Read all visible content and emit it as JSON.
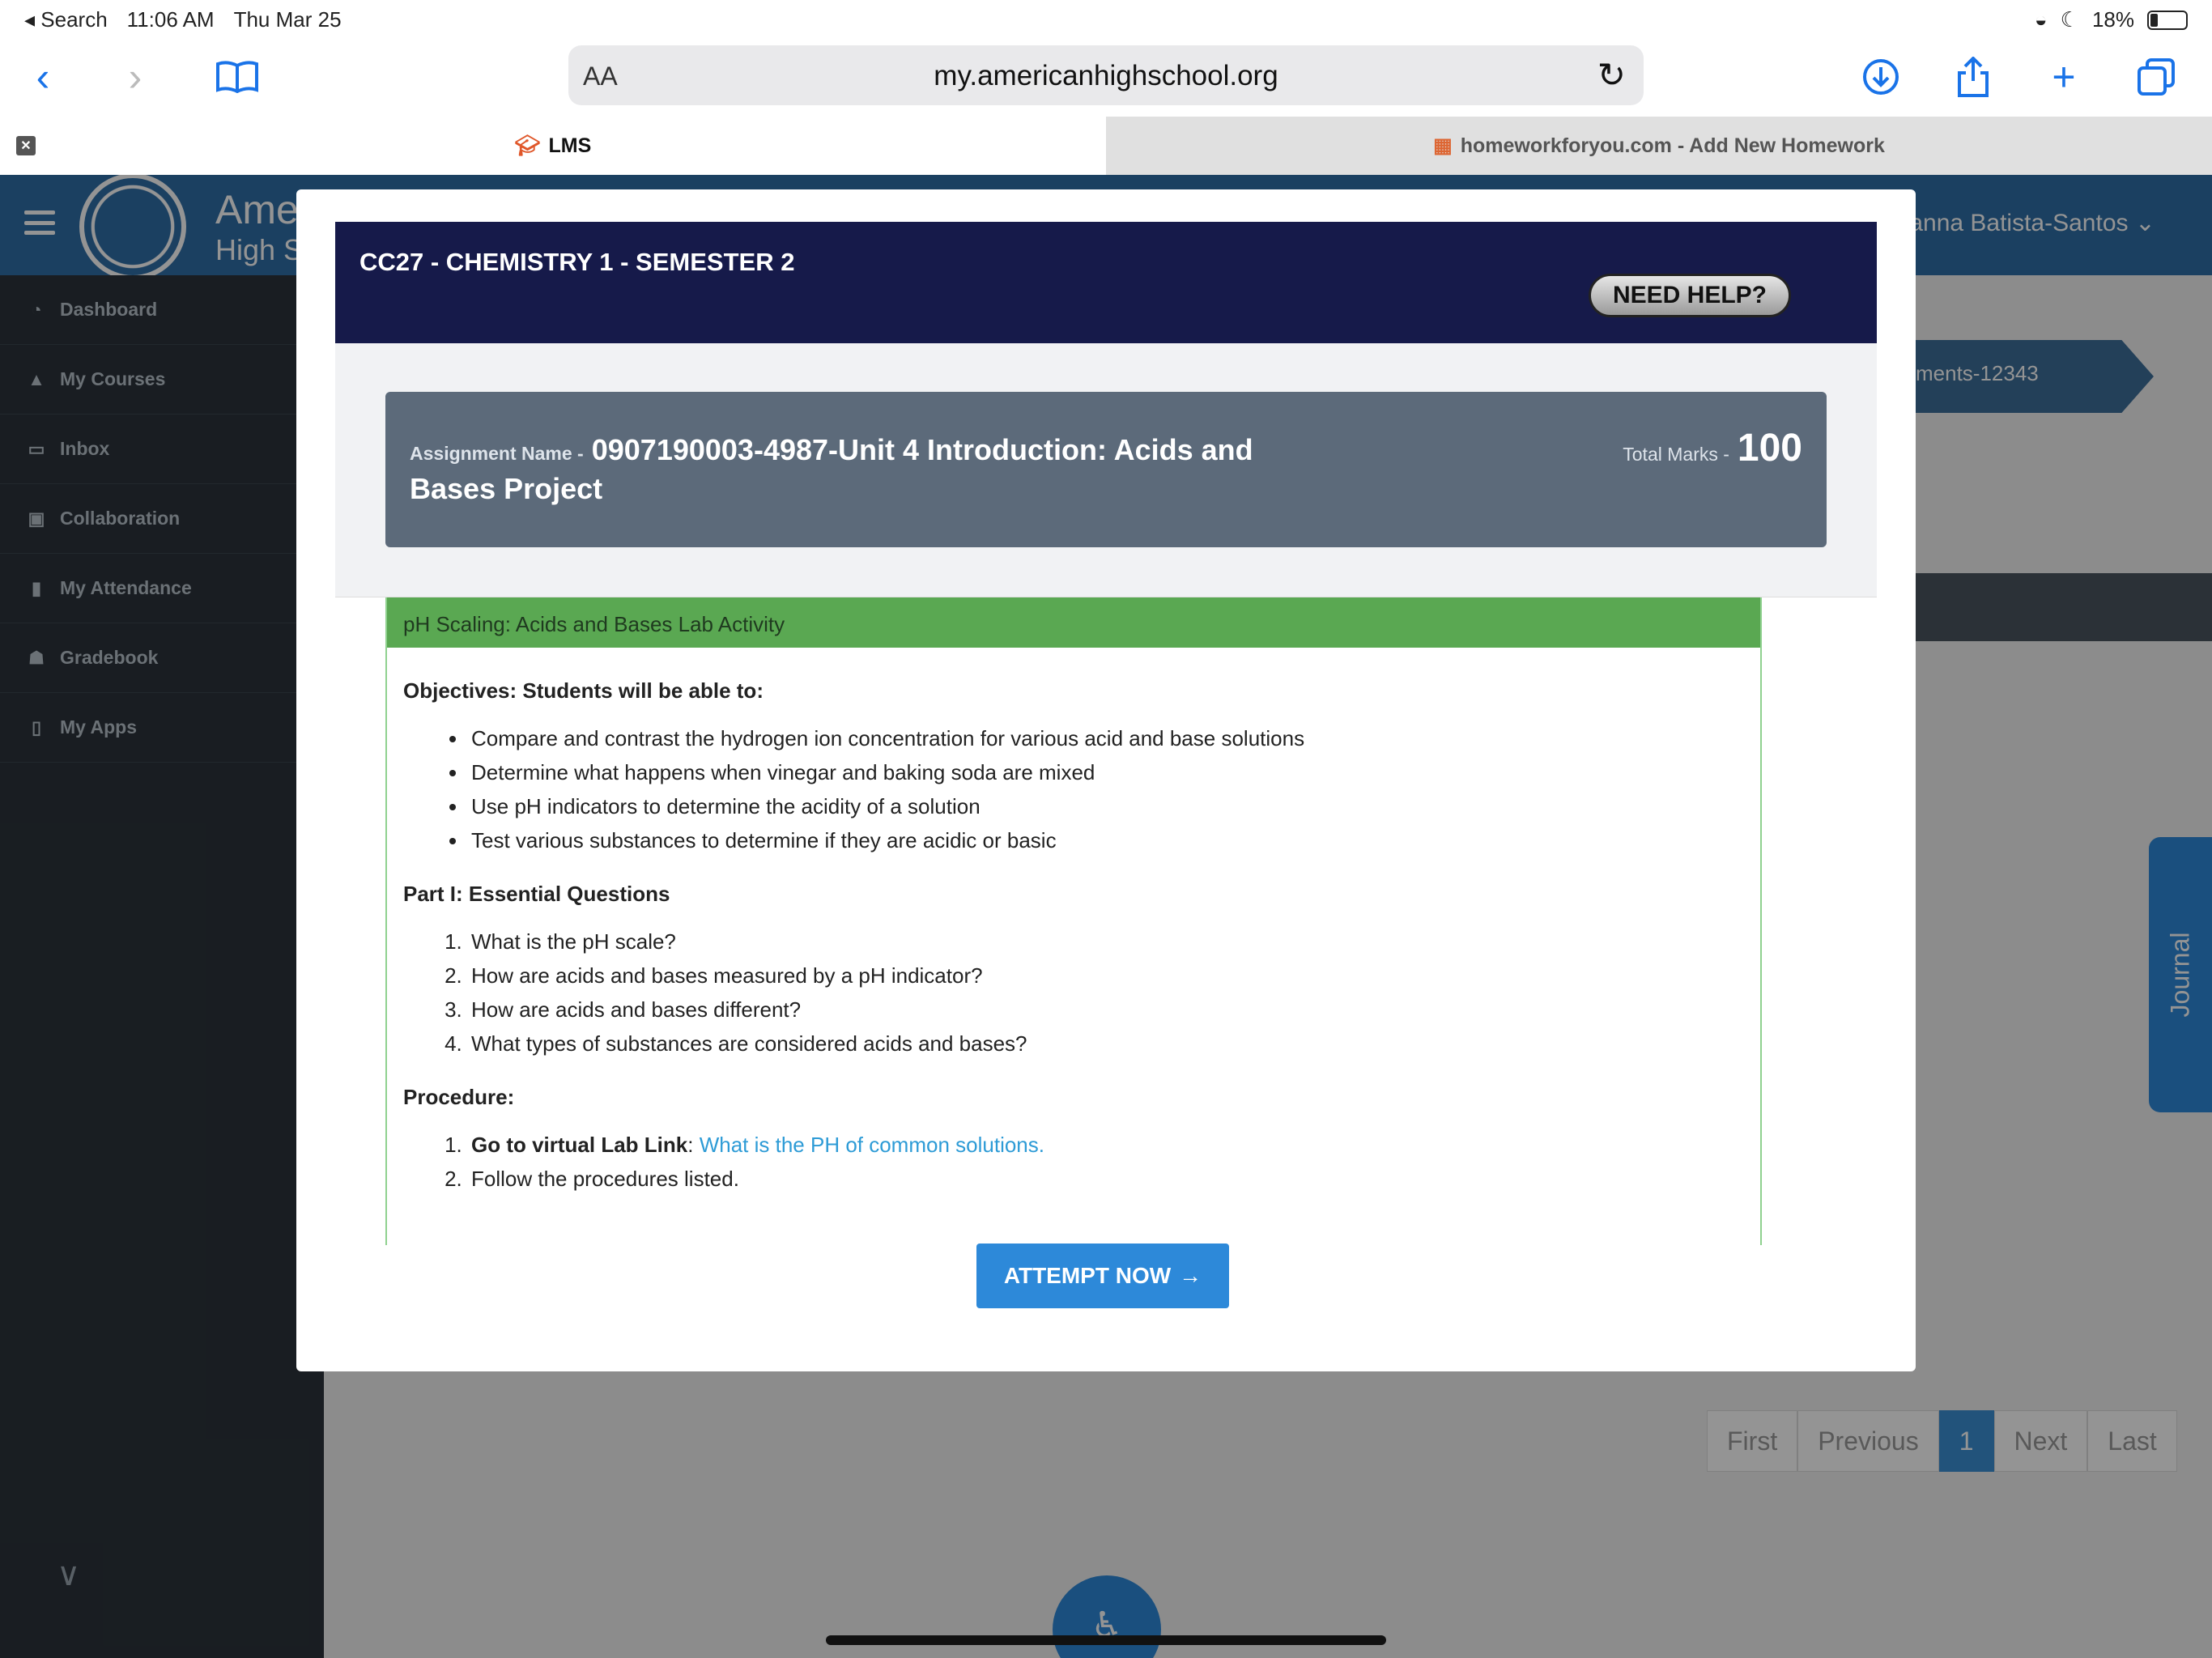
{
  "status_bar": {
    "back_app": "◂ Search",
    "time": "11:06 AM",
    "date": "Thu Mar 25",
    "battery": "18%"
  },
  "browser": {
    "text_size": "AA",
    "url": "my.americanhighschool.org",
    "tabs": [
      {
        "label": "LMS"
      },
      {
        "label": "homeworkforyou.com - Add New Homework"
      }
    ]
  },
  "app": {
    "brand_line1": "Ame",
    "brand_line2": "High S",
    "user_name": "vanna Batista-Santos",
    "sidebar": [
      {
        "label": "Dashboard",
        "icon": "dashboard-icon"
      },
      {
        "label": "My Courses",
        "icon": "graduation-cap-icon"
      },
      {
        "label": "Inbox",
        "icon": "inbox-icon"
      },
      {
        "label": "Collaboration",
        "icon": "teams-icon"
      },
      {
        "label": "My Attendance",
        "icon": "clipboard-icon"
      },
      {
        "label": "Gradebook",
        "icon": "trophy-icon"
      },
      {
        "label": "My Apps",
        "icon": "mobile-icon"
      }
    ],
    "breadcrumb_fragment": "ments-12343",
    "journal_label": "Journal",
    "pagination": [
      "First",
      "Previous",
      "1",
      "Next",
      "Last"
    ]
  },
  "modal": {
    "title": "CC27 - CHEMISTRY 1 - SEMESTER 2",
    "need_help": "NEED HELP?",
    "assignment_label": "Assignment Name -",
    "assignment_name": "0907190003-4987-Unit 4 Introduction: Acids and Bases Project",
    "total_marks_label": "Total Marks -",
    "total_marks": "100",
    "content_title": "pH Scaling: Acids and Bases Lab Activity",
    "objectives_heading": "Objectives: Students will be able to:",
    "objectives": [
      "Compare and contrast the hydrogen ion concentration for various acid and base solutions",
      "Determine what happens when vinegar and baking soda are mixed",
      "Use pH indicators to determine the acidity of a solution",
      "Test various substances to determine if they are acidic or basic"
    ],
    "part1_heading": "Part I: Essential Questions",
    "questions": [
      "What is the pH scale?",
      "How are acids and bases measured by a pH indicator?",
      "How are acids and bases different?",
      "What types of substances are considered acids and bases?"
    ],
    "procedure_heading": "Procedure:",
    "procedure_step1_bold": "Go to virtual Lab Link",
    "procedure_step1_sep": ": ",
    "procedure_step1_link": "What is the PH of common solutions.",
    "procedure_step2": "Follow the procedures listed.",
    "attempt_button": "ATTEMPT NOW"
  }
}
